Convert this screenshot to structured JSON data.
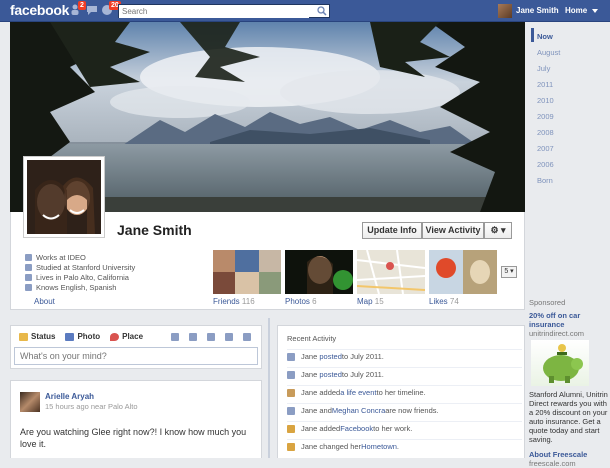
{
  "topbar": {
    "logo": "facebook",
    "friend_requests_badge": "2",
    "notifications_badge": "20",
    "search_placeholder": "Search",
    "user_name": "Jane Smith",
    "home_label": "Home"
  },
  "profile": {
    "name": "Jane Smith",
    "update_info_label": "Update Info",
    "view_activity_label": "View Activity",
    "settings_label": "⚙ ▾",
    "info": [
      "Works at IDEO",
      "Studied at Stanford University",
      "Lives in Palo Alto, California",
      "Knows English, Spanish"
    ],
    "about_label": "About",
    "tiles": [
      {
        "label": "Friends",
        "count": "116"
      },
      {
        "label": "Photos",
        "count": "6"
      },
      {
        "label": "Map",
        "count": "15"
      },
      {
        "label": "Likes",
        "count": "74"
      }
    ],
    "more_label": "5 ▾"
  },
  "timeline_nav": [
    "Now",
    "August",
    "July",
    "2011",
    "2010",
    "2009",
    "2008",
    "2007",
    "2006",
    "Born"
  ],
  "sponsored": {
    "header": "Sponsored",
    "title": "20% off on car insurance",
    "url": "unitrindirect.com",
    "body": "Stanford Alumni, Unitrin Direct rewards you with a 20% discount on your auto insurance. Get a quote today and start saving.",
    "next_title": "About Freescale",
    "next_url": "freescale.com"
  },
  "composer": {
    "status_label": "Status",
    "photo_label": "Photo",
    "place_label": "Place",
    "input_placeholder": "What's on your mind?"
  },
  "post": {
    "author": "Arielle Aryah",
    "meta": "15 hours ago near Palo Alto",
    "text": "Are you watching Glee right now?! I know how much you love it."
  },
  "activity": {
    "header": "Recent Activity",
    "rows": [
      {
        "a": "Jane ",
        "b": "posted",
        "c": " to July 2011."
      },
      {
        "a": "Jane ",
        "b": "posted",
        "c": " to July 2011."
      },
      {
        "a": "Jane added ",
        "b": "a life event",
        "c": " to her timeline."
      },
      {
        "a": "Jane and ",
        "b": "Meghan Concra",
        "c": " are now friends."
      },
      {
        "a": "Jane added ",
        "b": "Facebook",
        "c": " to her work."
      },
      {
        "a": "Jane changed her ",
        "b": "Hometown",
        "c": "."
      }
    ]
  }
}
